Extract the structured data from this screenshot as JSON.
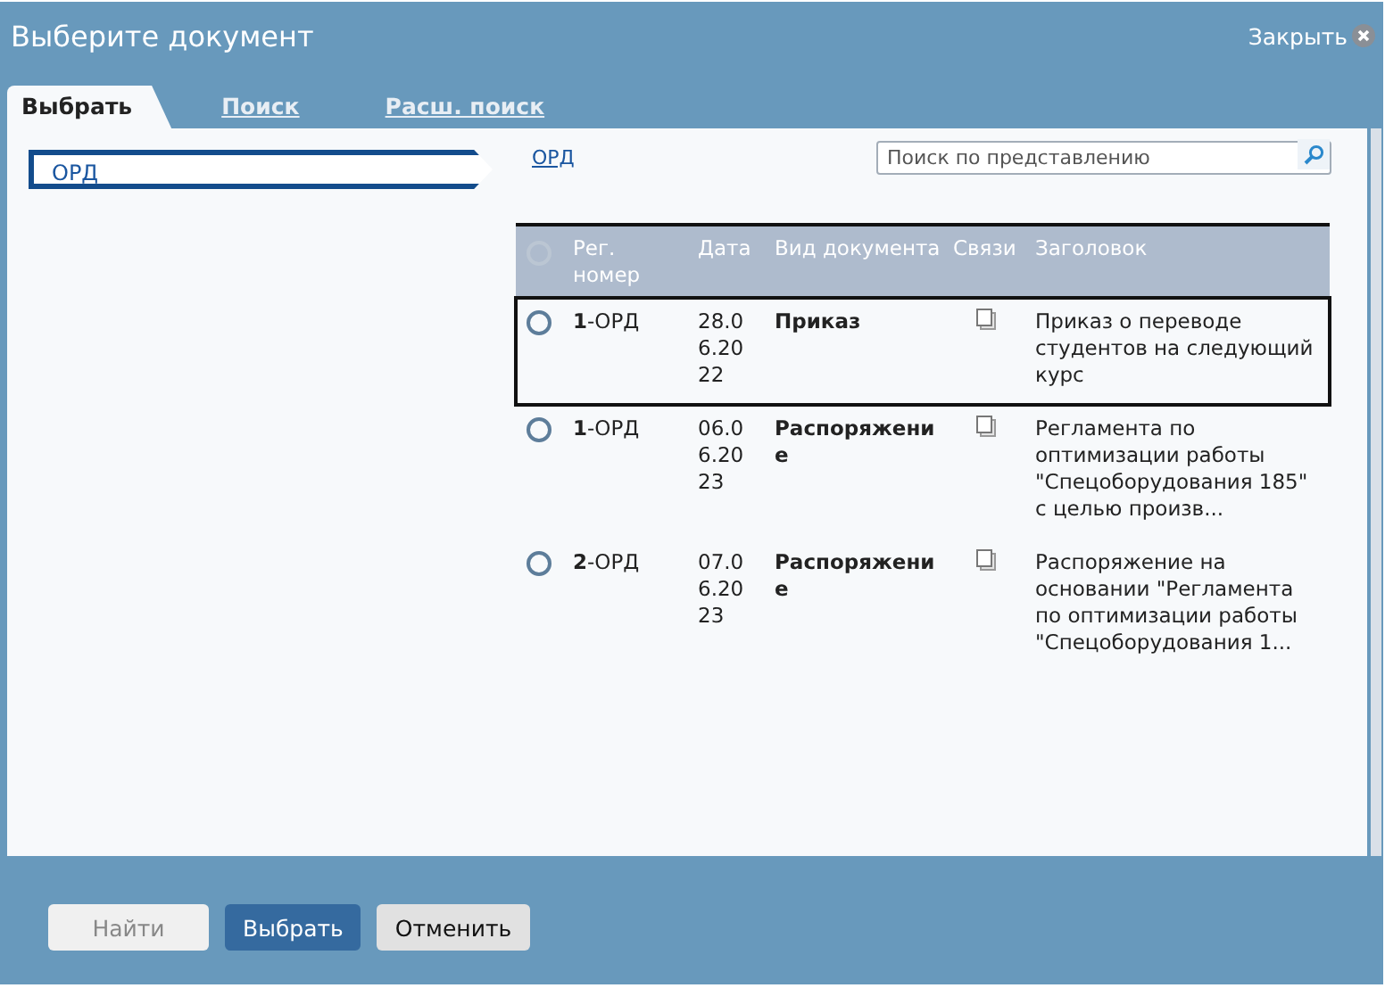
{
  "window": {
    "title": "Выберите документ",
    "close_label": "Закрыть"
  },
  "tabs": [
    {
      "label": "Выбрать",
      "selected": true
    },
    {
      "label": "Поиск",
      "selected": false
    },
    {
      "label": "Расш. поиск",
      "selected": false
    }
  ],
  "breadcrumb": {
    "label": "ОРД"
  },
  "path_link": "ОРД",
  "search": {
    "placeholder": "Поиск по представлению"
  },
  "table": {
    "select_all": {
      "disabled": true
    },
    "columns": [
      "Рег. номер",
      "Дата",
      "Вид документа",
      "Связи",
      "Заголовок"
    ],
    "rows": [
      {
        "selected": true,
        "checked": false,
        "reg_number": "**1**-ОРД",
        "date": "28.06.2022",
        "doc_type": "Приказ",
        "title": "Приказ о переводе студентов на следующий курс"
      },
      {
        "selected": false,
        "checked": false,
        "reg_number": "**1**-ОРД",
        "date": "06.06.2023",
        "doc_type": "Распоряжение",
        "title": "Регламента по оптимизации работы \"Спецоборудования 185\" с целью произв..."
      },
      {
        "selected": false,
        "checked": false,
        "reg_number": "**2**-ОРД",
        "date": "07.06.2023",
        "doc_type": "Распоряжение",
        "title": "Распоряжение на основании \"Регламента по оптимизации работы \"Спецоборудования 1..."
      }
    ]
  },
  "buttons": [
    {
      "label": "Найти",
      "kind": "plain",
      "disabled": true
    },
    {
      "label": "Выбрать",
      "kind": "primary",
      "disabled": false
    },
    {
      "label": "Отменить",
      "kind": "plain",
      "disabled": false
    }
  ]
}
